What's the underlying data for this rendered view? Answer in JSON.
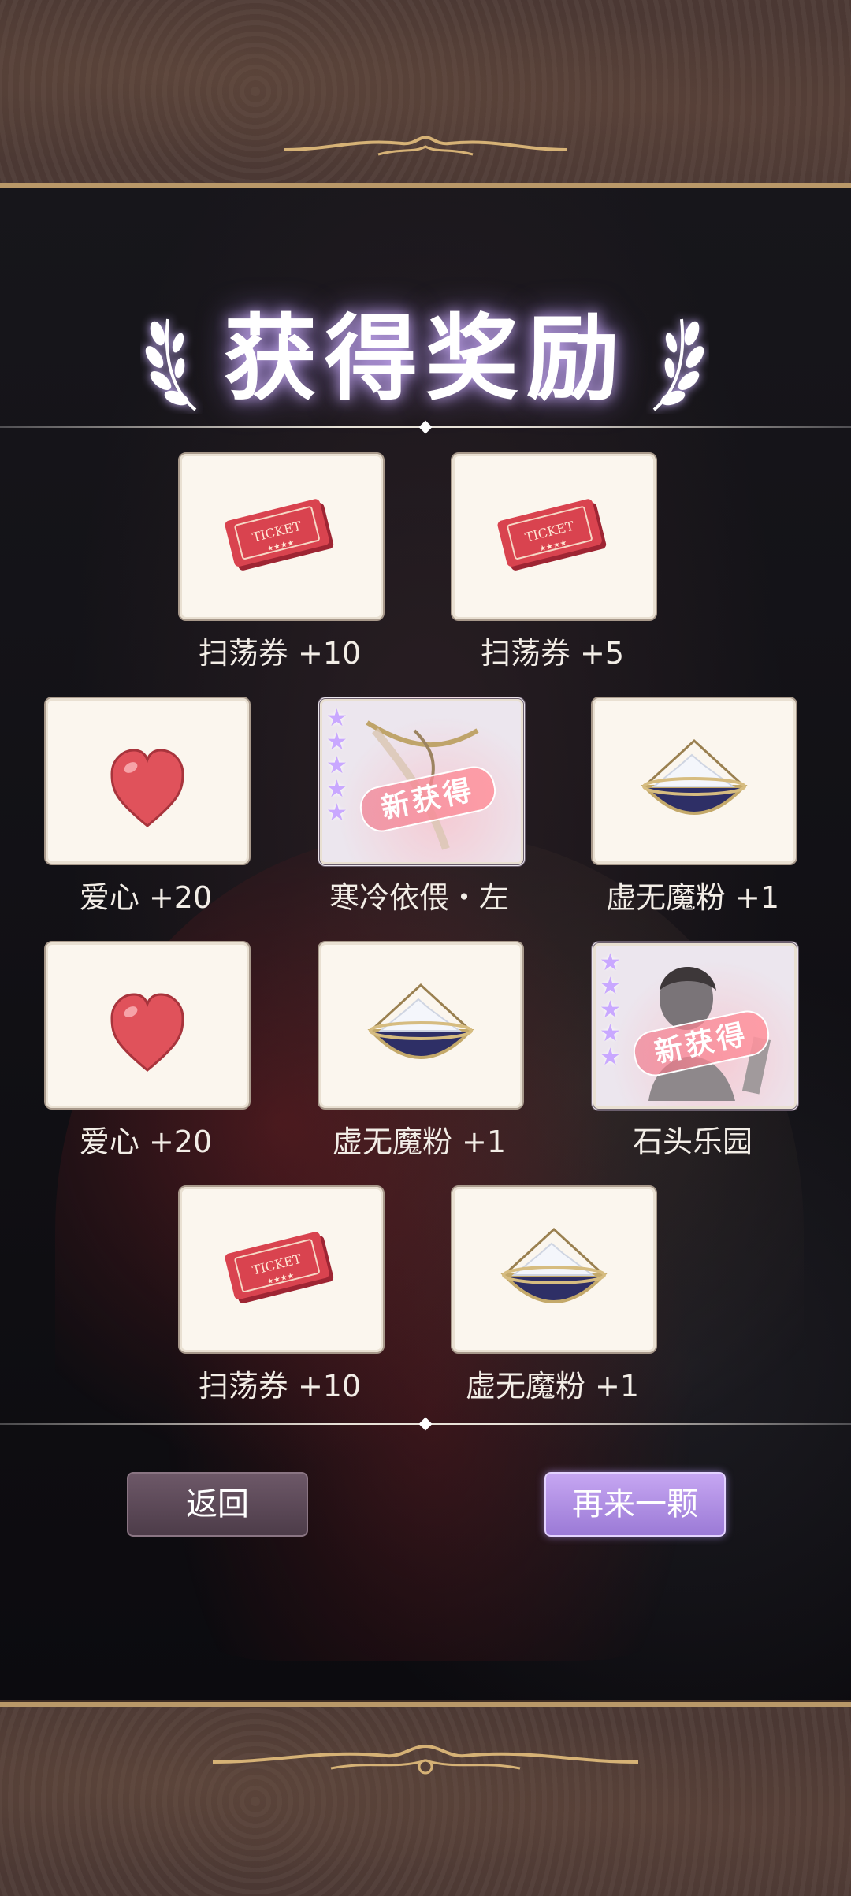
{
  "title": "获得奖励",
  "rewards": [
    {
      "name": "扫荡券 +10",
      "icon": "ticket-icon"
    },
    {
      "name": "扫荡券 +5",
      "icon": "ticket-icon"
    },
    {
      "name": "爱心 +20",
      "icon": "heart-icon"
    },
    {
      "name": "寒冷依偎・左",
      "icon": "card-art-icon",
      "badge": "新获得",
      "stars": 5
    },
    {
      "name": "虚无魔粉 +1",
      "icon": "magic-powder-icon"
    },
    {
      "name": "爱心 +20",
      "icon": "heart-icon"
    },
    {
      "name": "虚无魔粉 +1",
      "icon": "magic-powder-icon"
    },
    {
      "name": "石头乐园",
      "icon": "card-art-icon",
      "badge": "新获得",
      "stars": 5
    },
    {
      "name": "扫荡券 +10",
      "icon": "ticket-icon"
    },
    {
      "name": "虚无魔粉 +1",
      "icon": "magic-powder-icon"
    }
  ],
  "buttons": {
    "back": "返回",
    "again": "再来一颗"
  },
  "colors": {
    "accent": "#b18ee6",
    "gold": "#b99868",
    "card_bg": "#fbf6ee"
  }
}
